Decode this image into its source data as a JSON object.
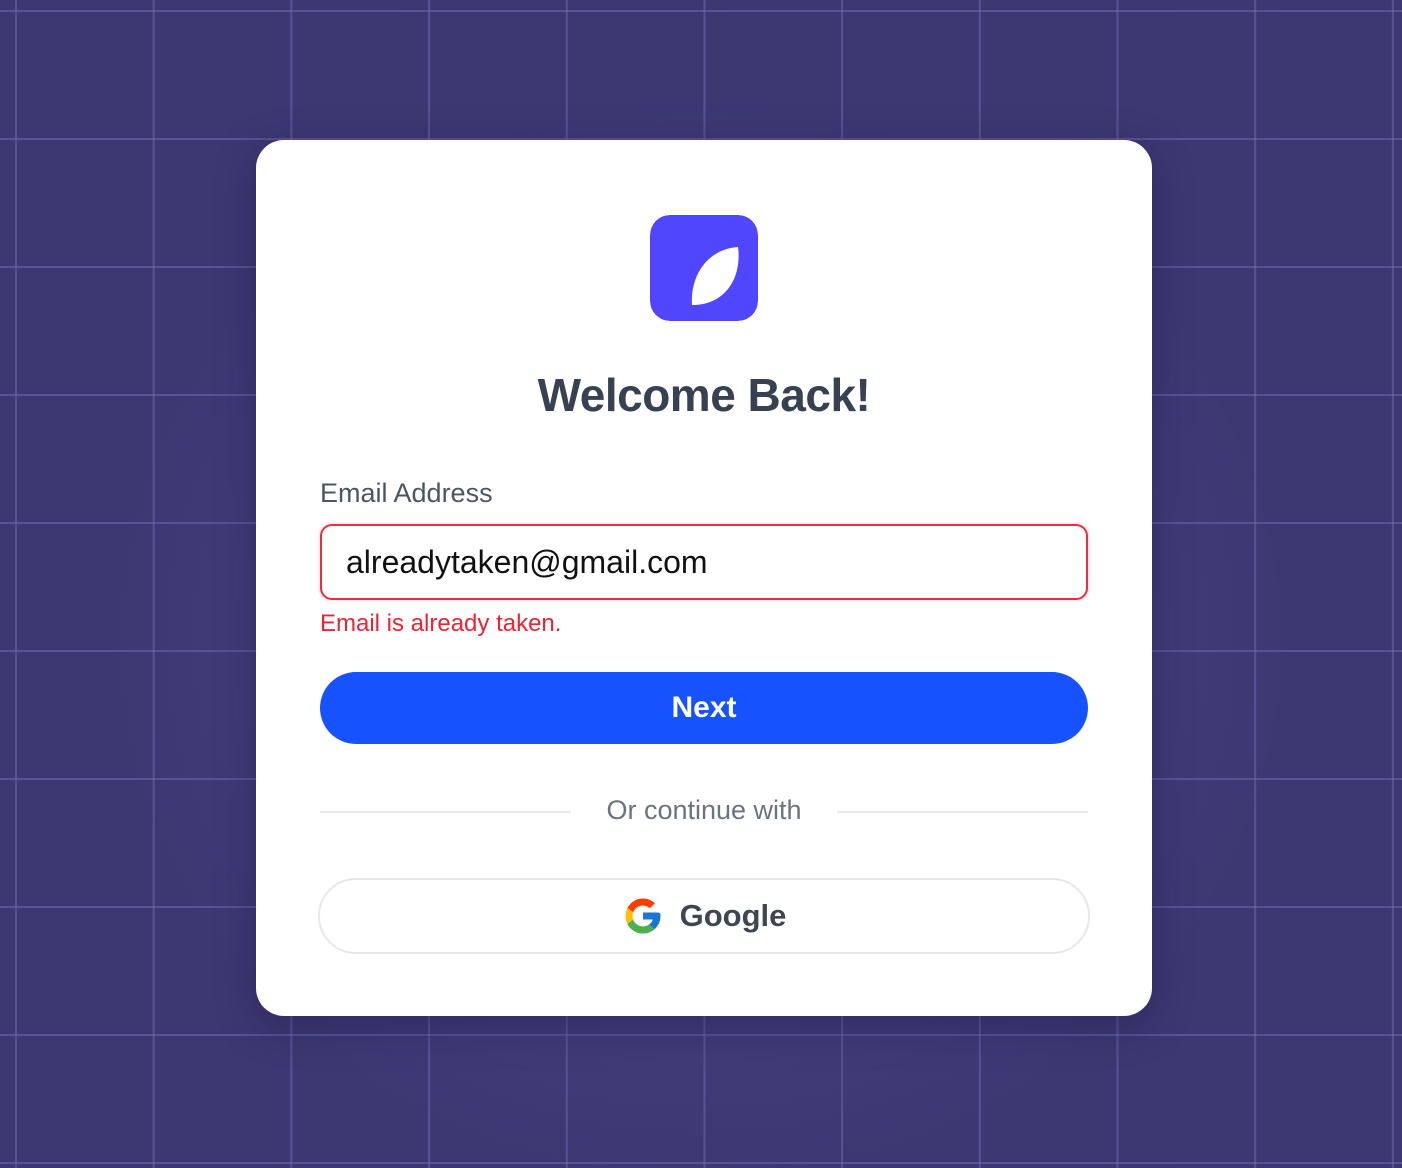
{
  "brand": {
    "logo_icon": "leaf-icon",
    "logo_color": "#4f46fe"
  },
  "login": {
    "title": "Welcome Back!",
    "email_label": "Email Address",
    "email_value": "alreadytaken@gmail.com",
    "email_error": "Email is already taken.",
    "next_label": "Next",
    "divider_text": "Or continue with",
    "google_label": "Google",
    "google_icon": "google-icon"
  },
  "colors": {
    "primary": "#1652fd",
    "error": "#ee2233",
    "background": "#3d3872"
  }
}
